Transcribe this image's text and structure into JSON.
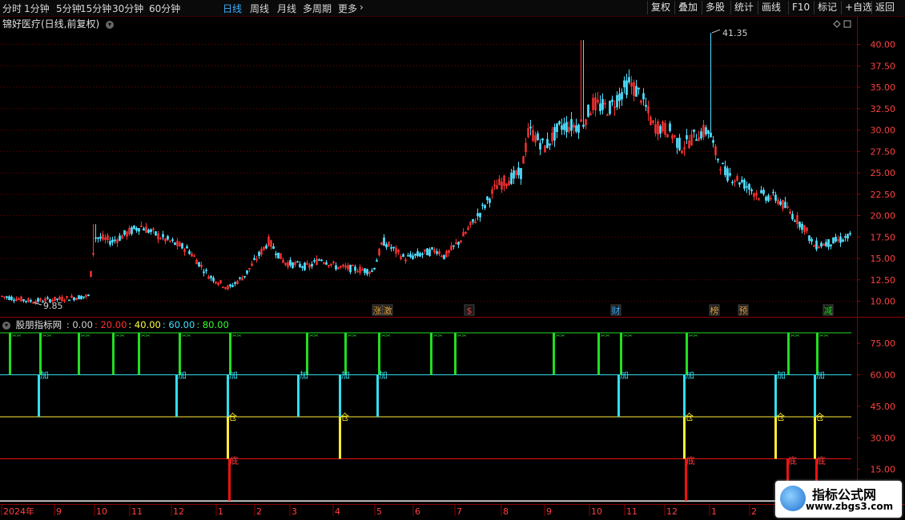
{
  "toolbar": {
    "periods": [
      "分时",
      "1分钟",
      "5分钟",
      "15分钟",
      "30分钟",
      "60分钟",
      "日线",
      "周线",
      "月线",
      "多周期",
      "更多"
    ],
    "active_period": "日线",
    "more_arrow": "›",
    "right_buttons": [
      "复权",
      "叠加",
      "多股",
      "统计",
      "画线",
      "F10",
      "标记",
      "+自选",
      "返回"
    ]
  },
  "main_chart": {
    "title": "锦好医疗(日线,前复权)",
    "y_ticks": [
      "40.00",
      "37.50",
      "35.00",
      "32.50",
      "30.00",
      "27.50",
      "25.00",
      "22.50",
      "20.00",
      "17.50",
      "15.00",
      "12.50",
      "10.00"
    ],
    "high_label": "41.35",
    "low_label": "9.85",
    "event_tags": [
      {
        "text": "涨",
        "color": "#e0a040"
      },
      {
        "text": "激",
        "color": "#e0a040"
      },
      {
        "text": "$",
        "color": "#e04040"
      },
      {
        "text": "财",
        "color": "#3ab0ff"
      },
      {
        "text": "榜",
        "color": "#e0a040"
      },
      {
        "text": "预",
        "color": "#e0a040"
      },
      {
        "text": "减",
        "color": "#20d020"
      }
    ]
  },
  "indicator": {
    "name": "股朋指标网",
    "params": [
      {
        "text": ": 0.00",
        "color": "#d0d0d0"
      },
      {
        "text": ": 20.00",
        "color": "#ff3030"
      },
      {
        "text": ": 40.00",
        "color": "#ffff40"
      },
      {
        "text": ": 60.00",
        "color": "#40e0ff"
      },
      {
        "text": ": 80.00",
        "color": "#30ff30"
      }
    ],
    "y_ticks": [
      "75.00",
      "60.00",
      "45.00",
      "30.00",
      "15.00"
    ],
    "bar_labels": {
      "green": "✂✂",
      "cyan": "加",
      "yellow": "仓",
      "red": "底"
    }
  },
  "x_axis": {
    "labels": [
      "2024年",
      "9",
      "10",
      "11",
      "12",
      "1",
      "2",
      "3",
      "4",
      "5",
      "6",
      "7",
      "8",
      "9",
      "10",
      "11",
      "12",
      "1",
      "2"
    ]
  },
  "colors": {
    "up": "#ff3232",
    "down": "#50e0ff",
    "grid": "#7a0000",
    "green": "#22dd22",
    "cyan": "#33ddee",
    "yellow": "#ffee33",
    "red": "#ee1111"
  },
  "watermark": {
    "title": "指标公式网",
    "url": "www.zbgs3.com"
  }
}
